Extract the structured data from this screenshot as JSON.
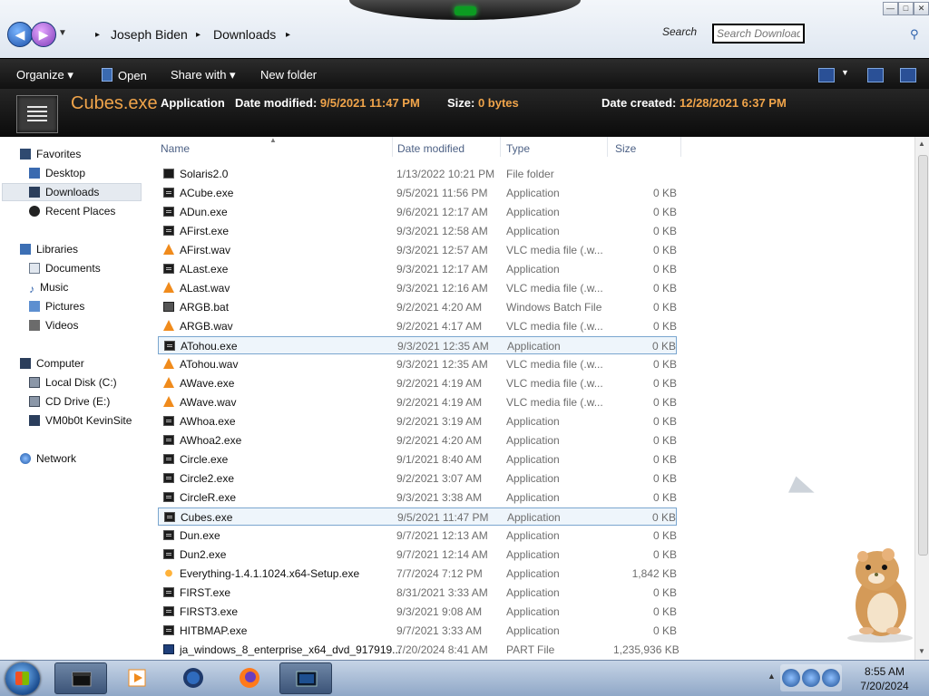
{
  "window": {
    "breadcrumb": {
      "user": "Joseph Biden",
      "folder": "Downloads"
    },
    "search": {
      "label": "Search",
      "placeholder": "Search Downloads"
    },
    "controls": {
      "minimize": "—",
      "maximize": "□",
      "close": "✕"
    }
  },
  "commandbar": {
    "organize": "Organize",
    "open": "Open",
    "share": "Share with",
    "newfolder": "New folder"
  },
  "details": {
    "name": "Cubes.exe",
    "type": "Application",
    "modified_label": "Date modified:",
    "modified_value": "9/5/2021 11:47 PM",
    "size_label": "Size:",
    "size_value": "0 bytes",
    "created_label": "Date created:",
    "created_value": "12/28/2021 6:37 PM"
  },
  "nav": {
    "favorites": "Favorites",
    "desktop": "Desktop",
    "downloads": "Downloads",
    "recent": "Recent Places",
    "libraries": "Libraries",
    "documents": "Documents",
    "music": "Music",
    "pictures": "Pictures",
    "videos": "Videos",
    "computer": "Computer",
    "localdisk": "Local Disk (C:)",
    "cddrive": "CD Drive (E:)",
    "vm": "VM0b0t KevinSite",
    "network": "Network"
  },
  "columns": {
    "name": "Name",
    "modified": "Date modified",
    "type": "Type",
    "size": "Size"
  },
  "files": [
    {
      "name": "Solaris2.0",
      "date": "1/13/2022 10:21 PM",
      "type": "File folder",
      "size": "",
      "icon": "folder"
    },
    {
      "name": "ACube.exe",
      "date": "9/5/2021 11:56 PM",
      "type": "Application",
      "size": "0 KB",
      "icon": "exe"
    },
    {
      "name": "ADun.exe",
      "date": "9/6/2021 12:17 AM",
      "type": "Application",
      "size": "0 KB",
      "icon": "exe"
    },
    {
      "name": "AFirst.exe",
      "date": "9/3/2021 12:58 AM",
      "type": "Application",
      "size": "0 KB",
      "icon": "exe"
    },
    {
      "name": "AFirst.wav",
      "date": "9/3/2021 12:57 AM",
      "type": "VLC media file (.w...",
      "size": "0 KB",
      "icon": "vlc"
    },
    {
      "name": "ALast.exe",
      "date": "9/3/2021 12:17 AM",
      "type": "Application",
      "size": "0 KB",
      "icon": "exe"
    },
    {
      "name": "ALast.wav",
      "date": "9/3/2021 12:16 AM",
      "type": "VLC media file (.w...",
      "size": "0 KB",
      "icon": "vlc"
    },
    {
      "name": "ARGB.bat",
      "date": "9/2/2021 4:20 AM",
      "type": "Windows Batch File",
      "size": "0 KB",
      "icon": "bat"
    },
    {
      "name": "ARGB.wav",
      "date": "9/2/2021 4:17 AM",
      "type": "VLC media file (.w...",
      "size": "0 KB",
      "icon": "vlc"
    },
    {
      "name": "ATohou.exe",
      "date": "9/3/2021 12:35 AM",
      "type": "Application",
      "size": "0 KB",
      "icon": "exe"
    },
    {
      "name": "ATohou.wav",
      "date": "9/3/2021 12:35 AM",
      "type": "VLC media file (.w...",
      "size": "0 KB",
      "icon": "vlc"
    },
    {
      "name": "AWave.exe",
      "date": "9/2/2021 4:19 AM",
      "type": "VLC media file (.w...",
      "size": "0 KB",
      "icon": "vlc"
    },
    {
      "name": "AWave.wav",
      "date": "9/2/2021 4:19 AM",
      "type": "VLC media file (.w...",
      "size": "0 KB",
      "icon": "vlc"
    },
    {
      "name": "AWhoa.exe",
      "date": "9/2/2021 3:19 AM",
      "type": "Application",
      "size": "0 KB",
      "icon": "exe"
    },
    {
      "name": "AWhoa2.exe",
      "date": "9/2/2021 4:20 AM",
      "type": "Application",
      "size": "0 KB",
      "icon": "exe"
    },
    {
      "name": "Circle.exe",
      "date": "9/1/2021 8:40 AM",
      "type": "Application",
      "size": "0 KB",
      "icon": "exe"
    },
    {
      "name": "Circle2.exe",
      "date": "9/2/2021 3:07 AM",
      "type": "Application",
      "size": "0 KB",
      "icon": "exe"
    },
    {
      "name": "CircleR.exe",
      "date": "9/3/2021 3:38 AM",
      "type": "Application",
      "size": "0 KB",
      "icon": "exe"
    },
    {
      "name": "Cubes.exe",
      "date": "9/5/2021 11:47 PM",
      "type": "Application",
      "size": "0 KB",
      "icon": "exe"
    },
    {
      "name": "Dun.exe",
      "date": "9/7/2021 12:13 AM",
      "type": "Application",
      "size": "0 KB",
      "icon": "exe"
    },
    {
      "name": "Dun2.exe",
      "date": "9/7/2021 12:14 AM",
      "type": "Application",
      "size": "0 KB",
      "icon": "exe"
    },
    {
      "name": "Everything-1.4.1.1024.x64-Setup.exe",
      "date": "7/7/2024 7:12 PM",
      "type": "Application",
      "size": "1,842 KB",
      "icon": "everything"
    },
    {
      "name": "FIRST.exe",
      "date": "8/31/2021 3:33 AM",
      "type": "Application",
      "size": "0 KB",
      "icon": "exe"
    },
    {
      "name": "FIRST3.exe",
      "date": "9/3/2021 9:08 AM",
      "type": "Application",
      "size": "0 KB",
      "icon": "exe"
    },
    {
      "name": "HITBMAP.exe",
      "date": "9/7/2021 3:33 AM",
      "type": "Application",
      "size": "0 KB",
      "icon": "exe"
    },
    {
      "name": "ja_windows_8_enterprise_x64_dvd_917919...",
      "date": "7/20/2024 8:41 AM",
      "type": "PART File",
      "size": "1,235,936 KB",
      "icon": "part"
    }
  ],
  "selected_index": 18,
  "hover_index": 9,
  "taskbar": {
    "time": "8:55 AM",
    "date": "7/20/2024"
  },
  "colors": {
    "accent": "#f0a44a",
    "selection": "#7aa6cf"
  }
}
